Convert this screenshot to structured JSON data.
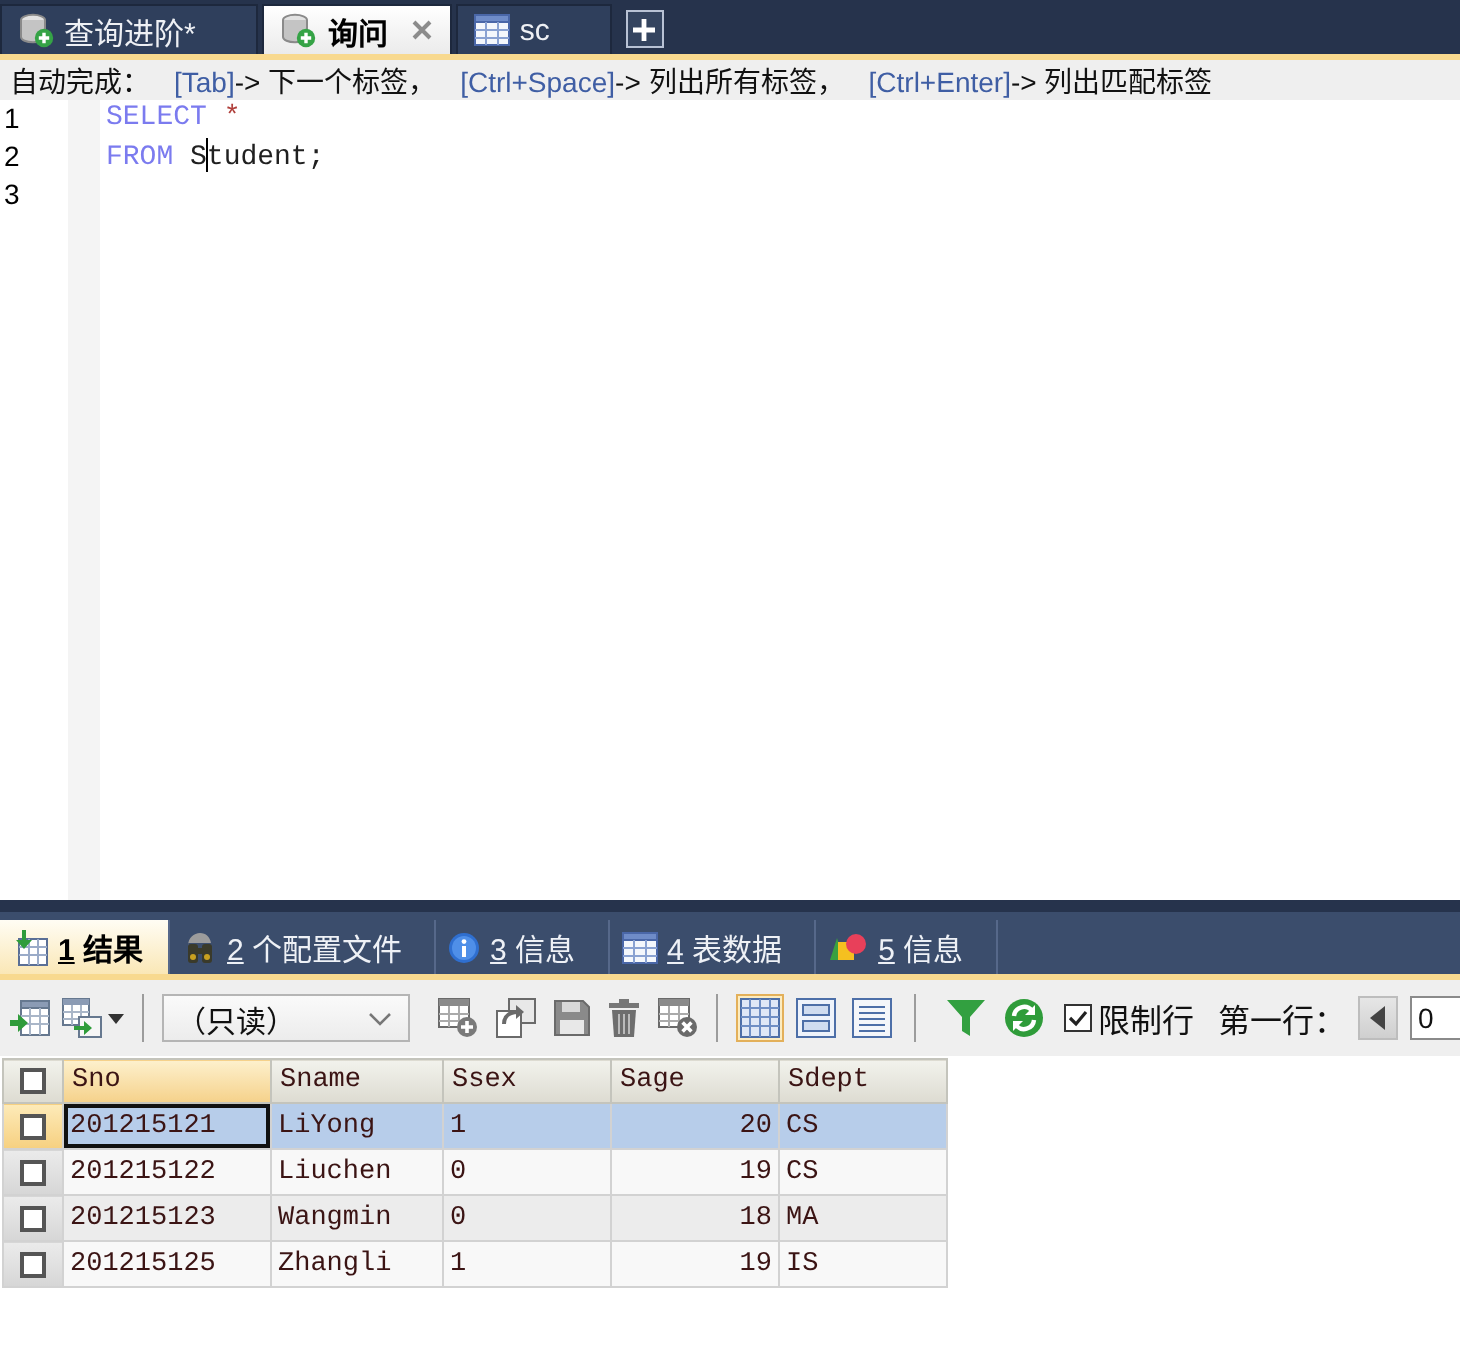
{
  "editor_tabs": [
    {
      "kind": "query",
      "label": "查询进阶*",
      "selected": false
    },
    {
      "kind": "query",
      "label": "询问",
      "selected": true
    },
    {
      "kind": "table",
      "label": "sc",
      "selected": false
    }
  ],
  "autocomplete": {
    "label": "自动完成：",
    "hints": [
      {
        "key": "[Tab]",
        "action": "-> 下一个标签，"
      },
      {
        "key": "[Ctrl+Space]",
        "action": "-> 列出所有标签，"
      },
      {
        "key": "[Ctrl+Enter]",
        "action": "-> 列出匹配标签"
      }
    ]
  },
  "editor": {
    "lines": [
      {
        "number": "1",
        "tokens": [
          {
            "kind": "keyword",
            "text": "SELECT "
          },
          {
            "kind": "operator",
            "text": "*"
          }
        ]
      },
      {
        "number": "2",
        "tokens": [
          {
            "kind": "keyword",
            "text": "FROM "
          },
          {
            "kind": "identifier",
            "text": "S"
          },
          {
            "kind": "caret"
          },
          {
            "kind": "identifier",
            "text": "tudent;"
          }
        ]
      },
      {
        "number": "3"
      }
    ]
  },
  "result_tabs": [
    {
      "kind": "result",
      "number": "1",
      "label": "结果",
      "selected": true
    },
    {
      "kind": "profile",
      "number": "2",
      "label": "个配置文件",
      "selected": false
    },
    {
      "kind": "info",
      "number": "3",
      "label": "信息",
      "selected": false
    },
    {
      "kind": "table",
      "number": "4",
      "label": "表数据",
      "selected": false
    },
    {
      "kind": "status",
      "number": "5",
      "label": "信息",
      "selected": false
    }
  ],
  "result_toolbar": {
    "mode_select": {
      "value": "（只读）"
    },
    "view_modes": [
      {
        "kind": "grid",
        "selected": true
      },
      {
        "kind": "form",
        "selected": false
      },
      {
        "kind": "text",
        "selected": false
      }
    ],
    "limit_rows": {
      "label": "限制行",
      "checked": true
    },
    "first_row": {
      "label": "第一行：",
      "value": "0"
    }
  },
  "result_grid": {
    "header_checked": false,
    "columns": [
      {
        "label": "Sno",
        "kind": "text",
        "selected": true
      },
      {
        "label": "Sname",
        "kind": "text",
        "selected": false
      },
      {
        "label": "Ssex",
        "kind": "text",
        "selected": false
      },
      {
        "label": "Sage",
        "kind": "number",
        "selected": false
      },
      {
        "label": "Sdept",
        "kind": "text",
        "selected": false
      }
    ],
    "rows": [
      {
        "selected": true,
        "checked": false,
        "cells": [
          "201215121",
          "LiYong",
          "1",
          "20",
          "CS"
        ]
      },
      {
        "selected": false,
        "checked": false,
        "cells": [
          "201215122",
          "Liuchen",
          "0",
          "19",
          "CS"
        ]
      },
      {
        "selected": false,
        "checked": false,
        "cells": [
          "201215123",
          "Wangmin",
          "0",
          "18",
          "MA"
        ]
      },
      {
        "selected": false,
        "checked": false,
        "cells": [
          "201215125",
          "Zhangli",
          "1",
          "19",
          "IS"
        ]
      }
    ]
  }
}
